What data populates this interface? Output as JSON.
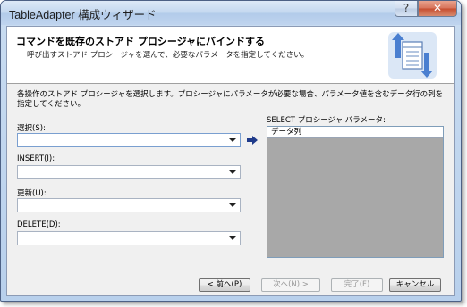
{
  "window": {
    "title": "TableAdapter 構成ウィザード",
    "help_label": "?",
    "close_label": "✕"
  },
  "header": {
    "title": "コマンドを既存のストアド プロシージャにバインドする",
    "subtitle": "呼び出すストアド プロシージャを選んで、必要なパラメータを指定してください。",
    "icon": "table-adapter-wizard-icon"
  },
  "main": {
    "description": "各操作のストアド プロシージャを選択します。プロシージャにパラメータが必要な場合、パラメータ値を含むデータ行の列を指定してください。",
    "fields": [
      {
        "label": "選択(S):",
        "value": ""
      },
      {
        "label": "INSERT(I):",
        "value": ""
      },
      {
        "label": "更新(U):",
        "value": ""
      },
      {
        "label": "DELETE(D):",
        "value": ""
      }
    ],
    "params": {
      "label": "SELECT プロシージャ パラメータ:",
      "column_header": "データ列"
    }
  },
  "buttons": {
    "back": "< 前へ(P)",
    "next": "次へ(N) >",
    "finish": "完了(F)",
    "cancel": "キャンセル"
  },
  "colors": {
    "titlebar": "#c3d7ef",
    "close": "#c64d2f",
    "accent_arrow": "#1f3a8a",
    "params_bg": "#a8a8a8"
  }
}
